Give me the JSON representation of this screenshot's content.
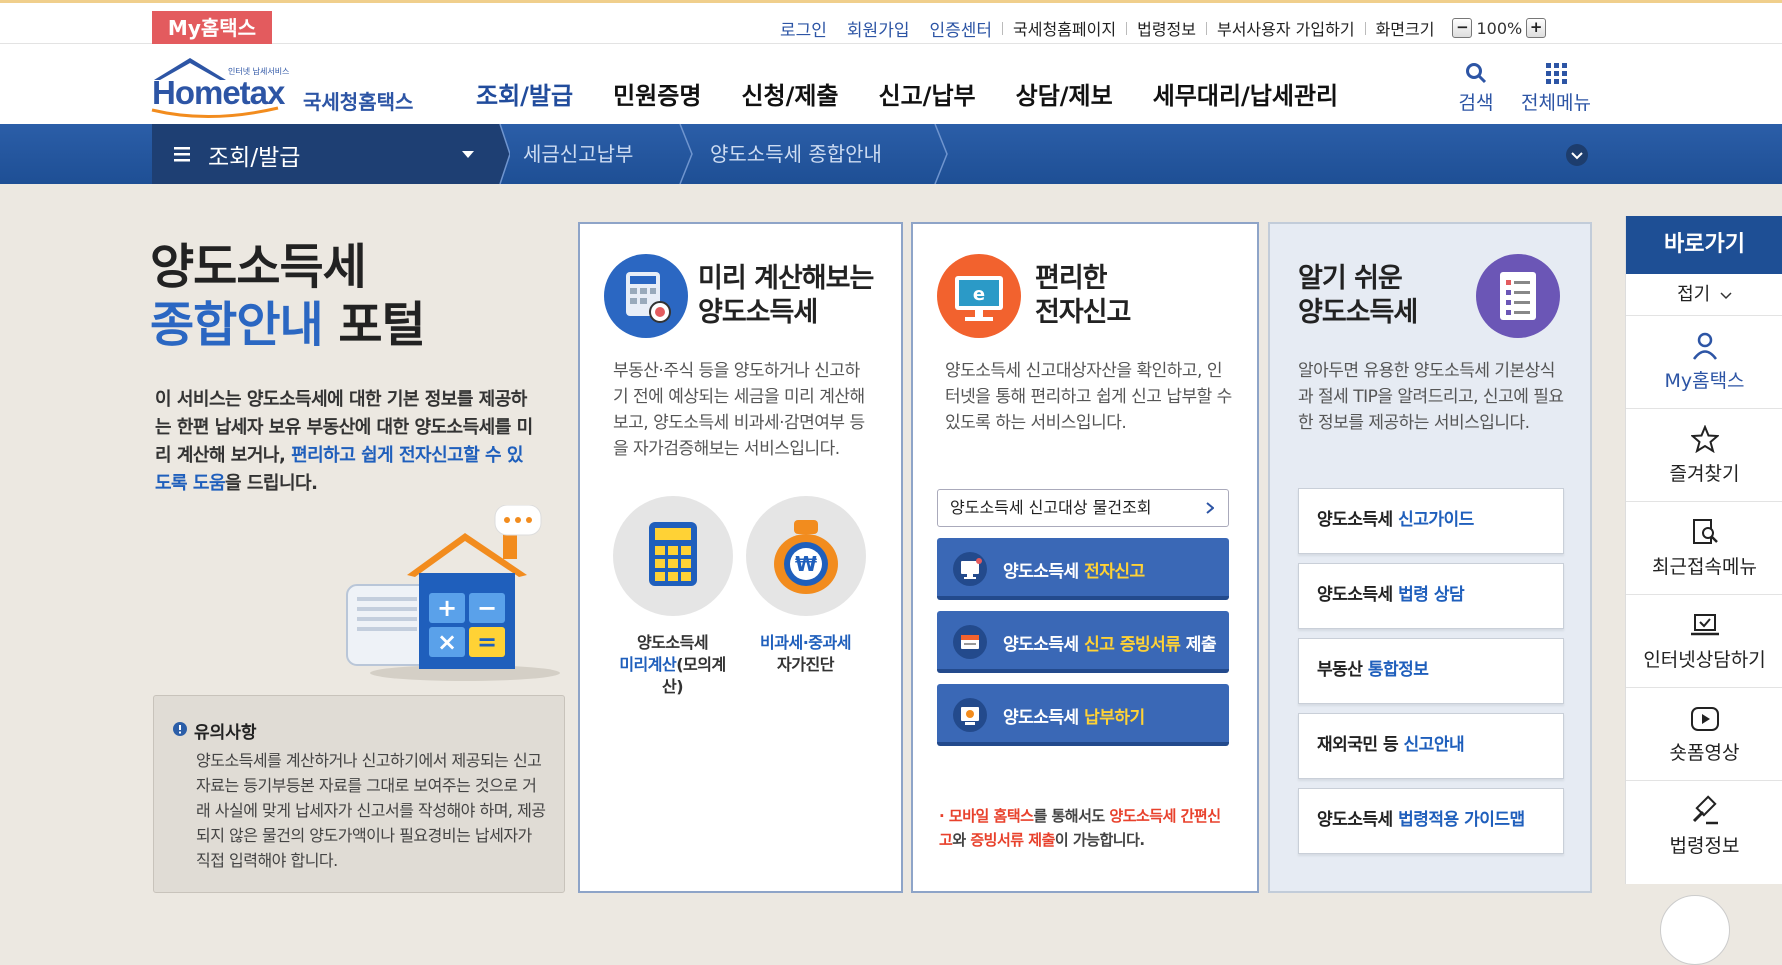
{
  "topbar": {
    "my_hometax": "My홈택스",
    "links": [
      "로그인",
      "회원가입",
      "인증센터",
      "국세청홈페이지",
      "법령정보",
      "부서사용자 가입하기",
      "화면크기"
    ],
    "zoom_minus": "−",
    "zoom_plus": "+",
    "zoom_value": "100%"
  },
  "logo": {
    "small": "인터넷 납세서비스",
    "name": "Hometax",
    "org": "국세청홈택스"
  },
  "gnb": [
    "조회/발급",
    "민원증명",
    "신청/제출",
    "신고/납부",
    "상담/제보",
    "세무대리/납세관리"
  ],
  "header_tools": {
    "search": "검색",
    "all_menu": "전체메뉴"
  },
  "breadcrumb": {
    "menu": "조회/발급",
    "item1": "세금신고납부",
    "item2": "양도소득세 종합안내"
  },
  "intro": {
    "title1": "양도소득세",
    "title2a": "종합안내",
    "title2b": " 포털",
    "text_a": "이 서비스는 양도소득세에 대한 기본 정보를 제공하는 한편 납세자 보유 부동산에 대한 양도소득세를 미리 계산해 보거나, ",
    "text_hl": "편리하고 쉽게 전자신고할 수 있도록 도움",
    "text_b": "을 드립니다."
  },
  "notice": {
    "title": "유의사항",
    "text": "양도소득세를 계산하거나 신고하기에서 제공되는 신고 자료는 등기부등본 자료를 그대로 보여주는 것으로 거래 사실에 맞게 납세자가 신고서를 작성해야 하며, 제공되지 않은 물건의 양도가액이나 필요경비는 납세자가 직접 입력해야 합니다."
  },
  "card1": {
    "title1": "미리 계산해보는",
    "title2": "양도소득세",
    "desc": "부동산·주식 등을 양도하거나 신고하기 전에 예상되는 세금을 미리 계산해보고, 양도소득세 비과세·감면여부 등을 자가검증해보는 서비스입니다.",
    "opt1_line1": "양도소득세",
    "opt1_hl": "미리계산",
    "opt1_tail": "(모의계산)",
    "opt2_hl": "비과세·중과세",
    "opt2_line2": "자가진단"
  },
  "card2": {
    "title1": "편리한",
    "title2": "전자신고",
    "desc": "양도소득세 신고대상자산을 확인하고, 인터넷을 통해 편리하고 쉽게 신고 납부할 수 있도록 하는 서비스입니다.",
    "lookup": "양도소득세 신고대상 물건조회",
    "btn1_a": "양도소득세 ",
    "btn1_hl": "전자신고",
    "btn2_a": "양도소득세 ",
    "btn2_hl": "신고 증빙서류",
    "btn2_b": " 제출",
    "btn3_a": "양도소득세 ",
    "btn3_hl": "납부하기",
    "note_a": "모바일 홈택스",
    "note_b": "를 통해서도 ",
    "note_c": "양도소득세 간편신고",
    "note_d": "와 ",
    "note_e": "증빙서류 제출",
    "note_f": "이 가능합니다."
  },
  "card3": {
    "title1": "알기 쉬운",
    "title2": "양도소득세",
    "desc": "알아두면 유용한 양도소득세 기본상식과 절세 TIP을 알려드리고, 신고에 필요한 정보를 제공하는 서비스입니다.",
    "items": [
      {
        "a": "양도소득세 ",
        "hl": "신고가이드"
      },
      {
        "a": "양도소득세 ",
        "hl": "법령 상담"
      },
      {
        "a": "부동산 ",
        "hl": "통합정보"
      },
      {
        "a": "재외국민 등 ",
        "hl": "신고안내"
      },
      {
        "a": "양도소득세 ",
        "hl": "법령적용 가이드맵"
      }
    ]
  },
  "quick": {
    "title": "바로가기",
    "fold": "접기",
    "items": [
      "My홈택스",
      "즐겨찾기",
      "최근접속메뉴",
      "인터넷상담하기",
      "숏폼영상",
      "법령정보"
    ]
  },
  "colors": {
    "brand_navy": "#1e4f95",
    "accent_blue": "#2b67c2",
    "my_red": "#e35b5e",
    "highlight_yellow": "#ffd235",
    "note_red": "#e8412c"
  }
}
